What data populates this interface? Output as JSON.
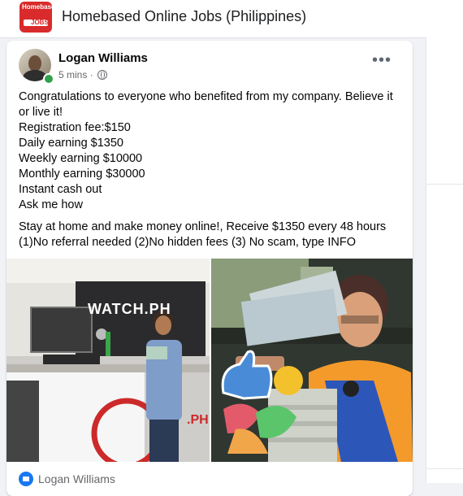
{
  "group": {
    "logo_text": "Homebased",
    "logo_jobs": "JOBS",
    "title": "Homebased Online Jobs (Philippines)"
  },
  "post": {
    "author": "Logan Williams",
    "time": "5 mins",
    "separator": "·",
    "more_label": "•••",
    "lines": [
      "Congratulations to everyone who benefited from my company. Believe it or live it!",
      "Registration fee:$150",
      "Daily earning $1350",
      "Weekly earning $10000",
      "Monthly earning $30000",
      "Instant cash out",
      "Ask me how"
    ],
    "lines2": [
      "Stay at home and make money online!, Receive $1350 every 48 hours",
      "(1)No referral needed (2)No hidden fees (3) No scam, type INFO"
    ],
    "photo_left_sign": "WATCH.PH",
    "photo_left_sign2": ".PH",
    "reactor_name": "Logan Williams"
  },
  "colors": {
    "brand_blue": "#1877f2",
    "online_green": "#31a24c",
    "logo_red": "#d92b2b"
  }
}
